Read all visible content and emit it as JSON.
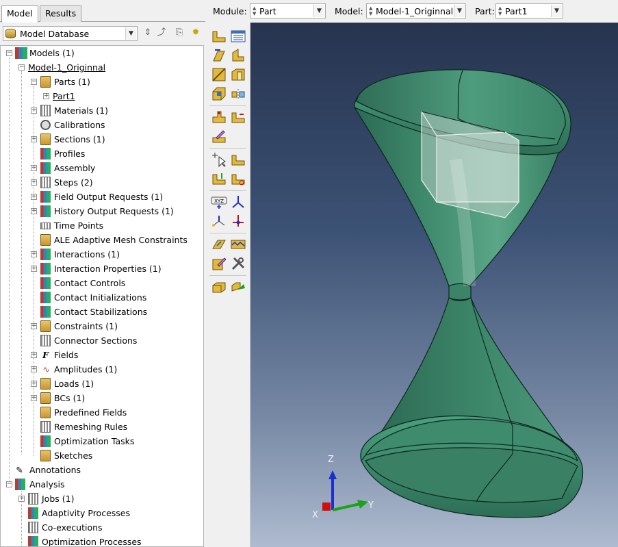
{
  "tabs": {
    "model": "Model",
    "results": "Results"
  },
  "database": {
    "selected": "Model Database"
  },
  "tree": {
    "models": "Models (1)",
    "model1": "Model-1_Originnal",
    "parts": "Parts (1)",
    "part1": "Part1",
    "materials": "Materials (1)",
    "calibrations": "Calibrations",
    "sections": "Sections (1)",
    "profiles": "Profiles",
    "assembly": "Assembly",
    "steps": "Steps (2)",
    "field_output": "Field Output Requests (1)",
    "history_output": "History Output Requests (1)",
    "time_points": "Time Points",
    "ale": "ALE Adaptive Mesh Constraints",
    "interactions": "Interactions (1)",
    "interaction_props": "Interaction Properties (1)",
    "contact_controls": "Contact Controls",
    "contact_init": "Contact Initializations",
    "contact_stab": "Contact Stabilizations",
    "constraints": "Constraints (1)",
    "connector_sections": "Connector Sections",
    "fields": "Fields",
    "amplitudes": "Amplitudes (1)",
    "loads": "Loads (1)",
    "bcs": "BCs (1)",
    "predefined_fields": "Predefined Fields",
    "remeshing": "Remeshing Rules",
    "opt_tasks": "Optimization Tasks",
    "sketches": "Sketches",
    "annotations": "Annotations",
    "analysis": "Analysis",
    "jobs": "Jobs (1)",
    "adaptivity": "Adaptivity Processes",
    "coexec": "Co-executions",
    "opt_processes": "Optimization Processes"
  },
  "context": {
    "module_label": "Module:",
    "module_value": "Part",
    "model_label": "Model:",
    "model_value": "Model-1_Originnal",
    "part_label": "Part:",
    "part_value": "Part1"
  },
  "triad": {
    "x": "X",
    "y": "Y",
    "z": "Z"
  },
  "colors": {
    "part_fill": "#3e8a6e",
    "part_edge": "#0f2a22",
    "viewport_top": "#26344f",
    "viewport_bottom": "#aebbd0",
    "axis_x": "#cc1111",
    "axis_y": "#1aa31a",
    "axis_z": "#1a2fcc"
  }
}
